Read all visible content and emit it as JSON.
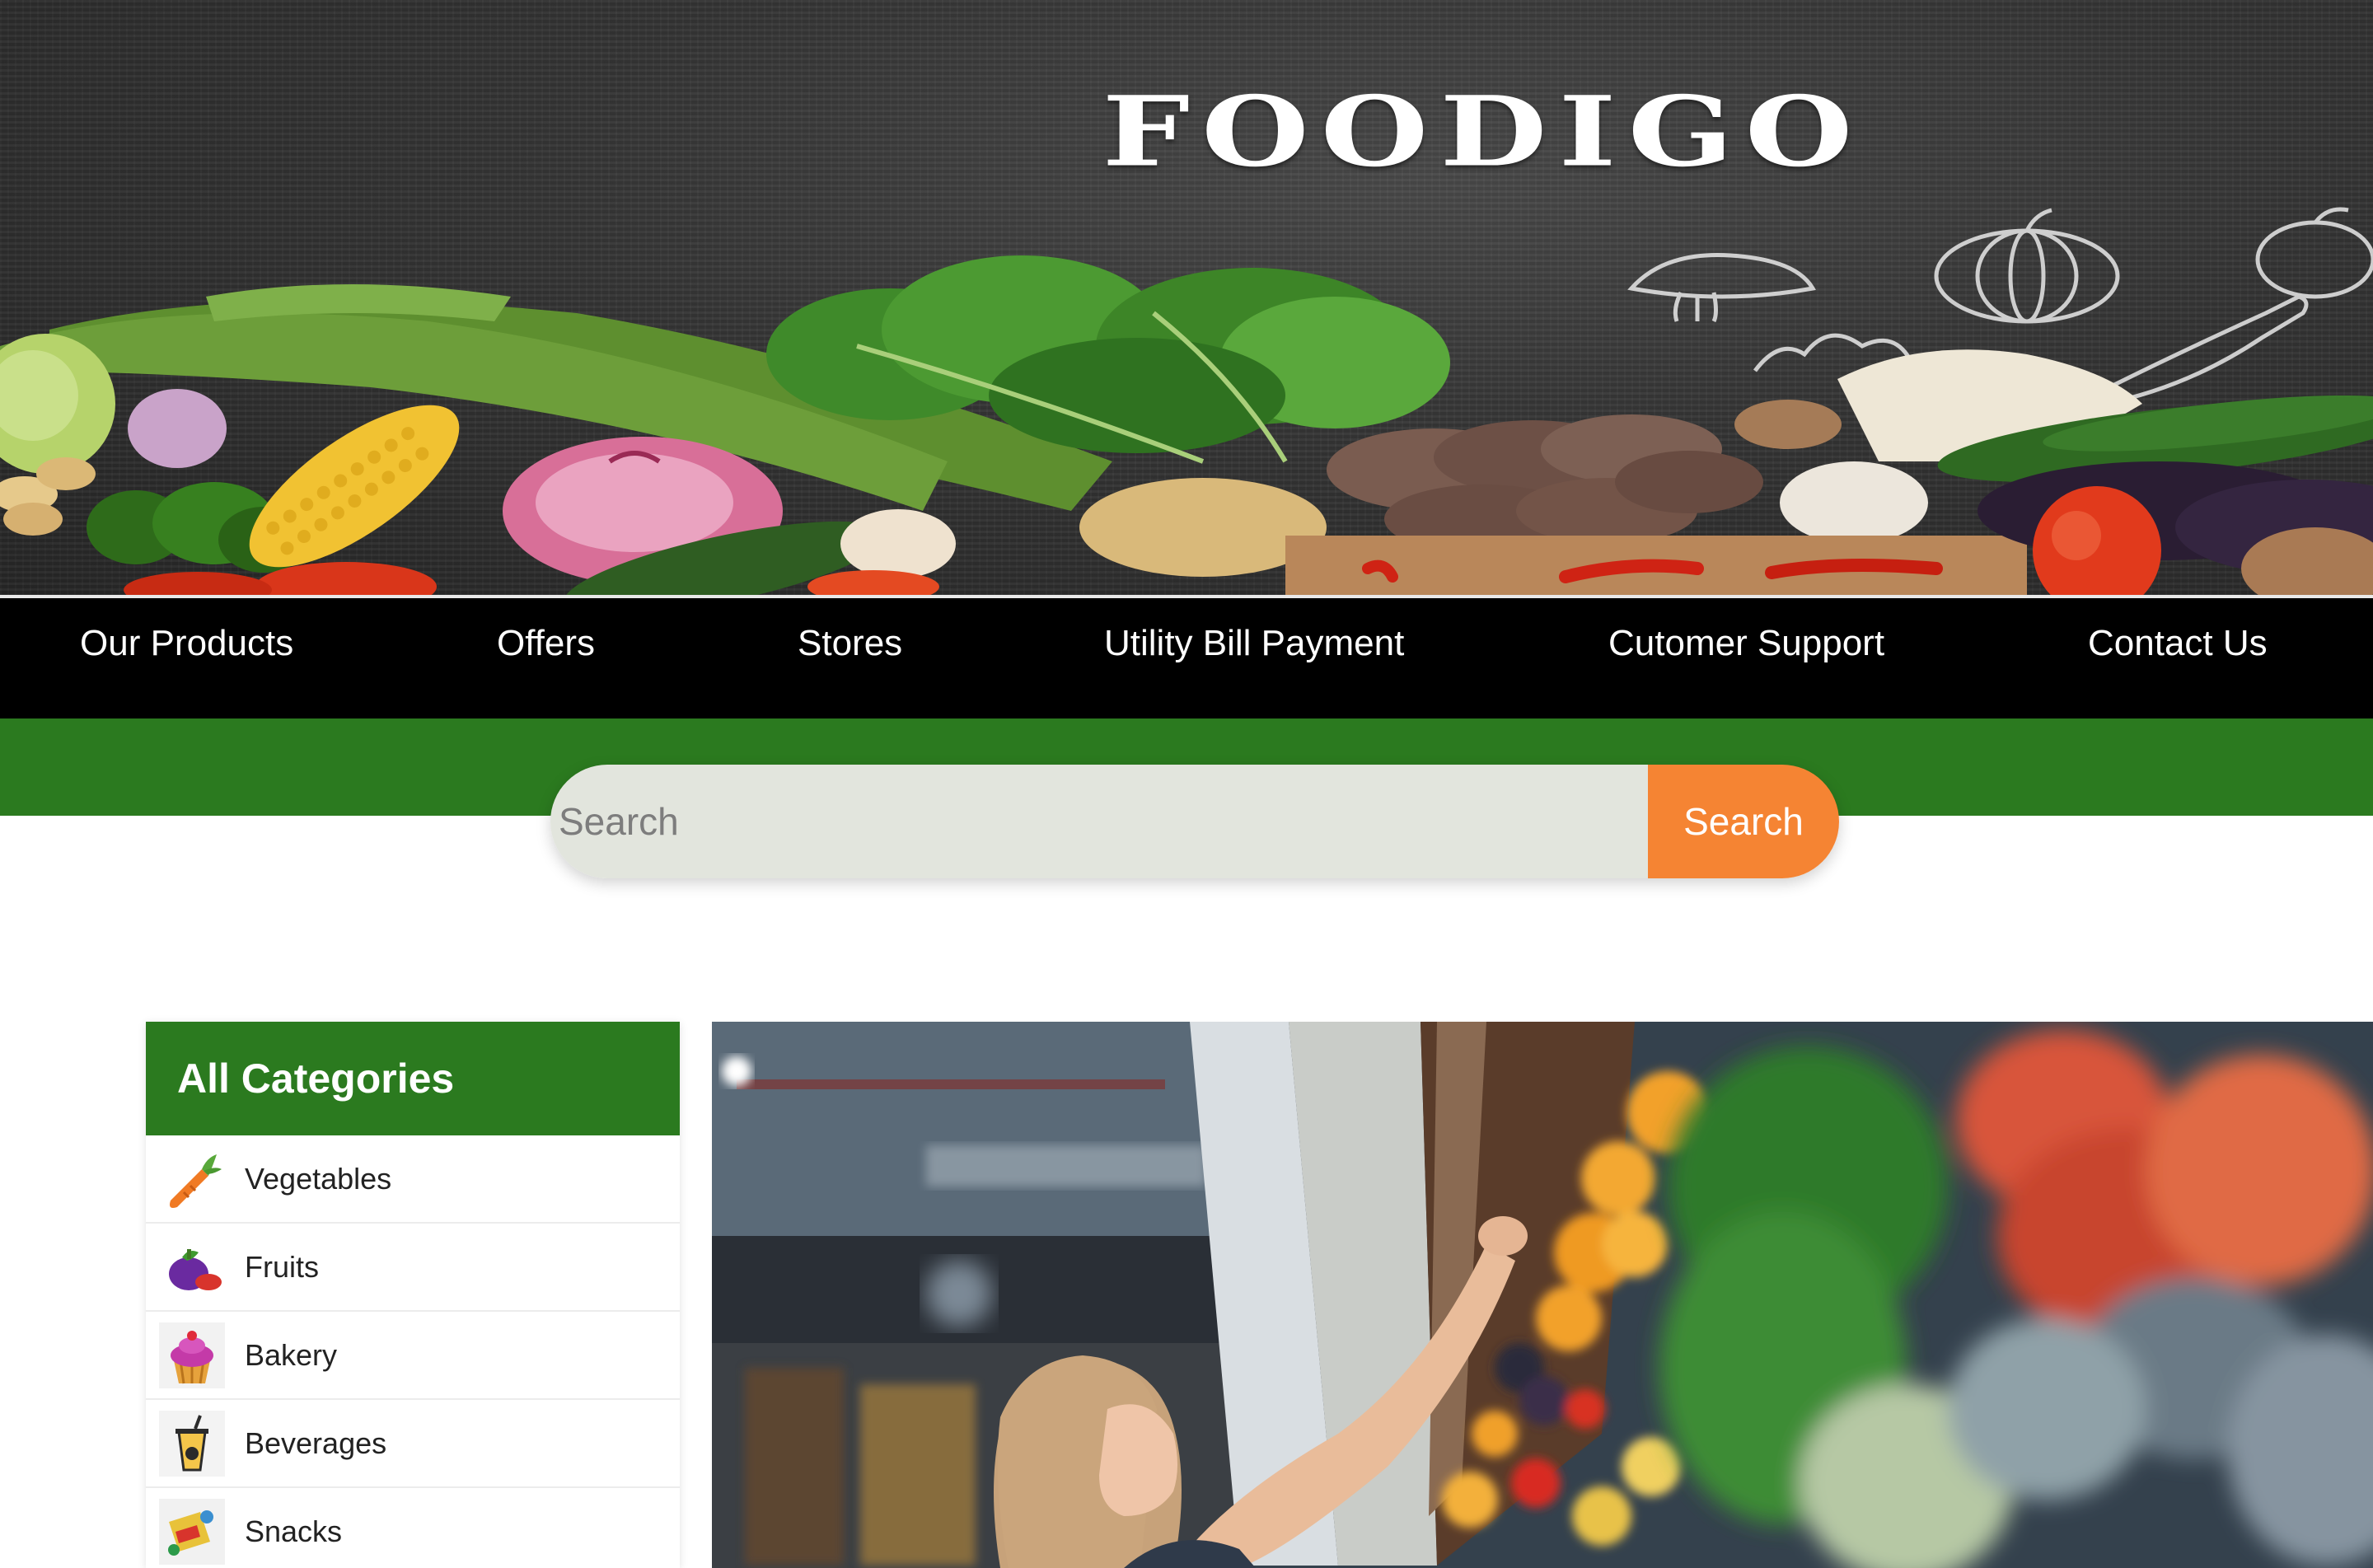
{
  "brand": {
    "name": "FOODIGO"
  },
  "nav": {
    "items": [
      {
        "label": "Our Products"
      },
      {
        "label": "Offers"
      },
      {
        "label": "Stores"
      },
      {
        "label": "Utility Bill Payment"
      },
      {
        "label": "Cutomer Support"
      },
      {
        "label": "Contact Us"
      }
    ]
  },
  "search": {
    "placeholder": "Search",
    "value": "",
    "button_label": "Search"
  },
  "categories": {
    "title": "All Categories",
    "items": [
      {
        "label": "Vegetables",
        "icon": "carrot-icon"
      },
      {
        "label": "Fruits",
        "icon": "eggplant-icon"
      },
      {
        "label": "Bakery",
        "icon": "cupcake-icon"
      },
      {
        "label": "Beverages",
        "icon": "drink-cup-icon"
      },
      {
        "label": "Snacks",
        "icon": "snacks-icon"
      }
    ]
  },
  "colors": {
    "nav_bg": "#000000",
    "accent_green": "#2b7a1f",
    "search_button": "#f58433",
    "search_field": "#e2e5dd"
  }
}
